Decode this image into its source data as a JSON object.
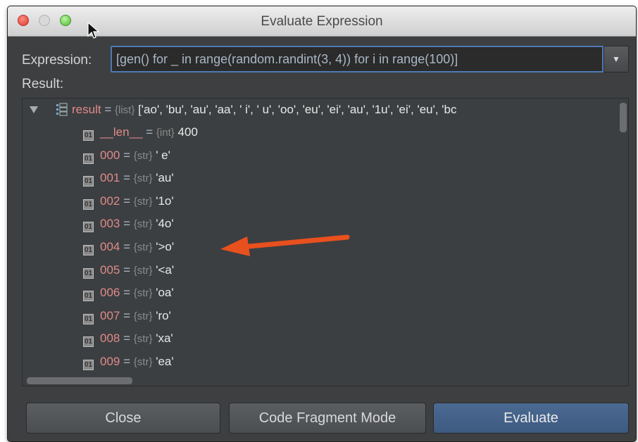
{
  "window": {
    "title": "Evaluate Expression"
  },
  "expression": {
    "label": "Expression:",
    "value": "[gen() for _ in range(random.randint(3, 4)) for i in range(100)]"
  },
  "result": {
    "label": "Result:",
    "root": {
      "name": "result",
      "eq": "=",
      "type": "{list}",
      "value": "['ao', 'bu', 'au', 'aa', ' i', ' u', 'oo', 'eu', 'ei', 'au', '1u', 'ei', 'eu', 'bc"
    },
    "children": [
      {
        "name": "__len__",
        "type": "{int}",
        "value": "400"
      },
      {
        "name": "000",
        "type": "{str}",
        "value": "' e'"
      },
      {
        "name": "001",
        "type": "{str}",
        "value": "'au'"
      },
      {
        "name": "002",
        "type": "{str}",
        "value": "'1o'"
      },
      {
        "name": "003",
        "type": "{str}",
        "value": "'4o'"
      },
      {
        "name": "004",
        "type": "{str}",
        "value": "'>o'"
      },
      {
        "name": "005",
        "type": "{str}",
        "value": "'<a'"
      },
      {
        "name": "006",
        "type": "{str}",
        "value": "'oa'"
      },
      {
        "name": "007",
        "type": "{str}",
        "value": "'ro'"
      },
      {
        "name": "008",
        "type": "{str}",
        "value": "'xa'"
      },
      {
        "name": "009",
        "type": "{str}",
        "value": "'ea'"
      }
    ]
  },
  "buttons": {
    "close": "Close",
    "code_fragment_mode": "Code Fragment Mode",
    "evaluate": "Evaluate"
  },
  "colors": {
    "accent": "#4f79b5",
    "annotation_arrow": "#e8501e",
    "variable_name": "#e08a8a"
  }
}
